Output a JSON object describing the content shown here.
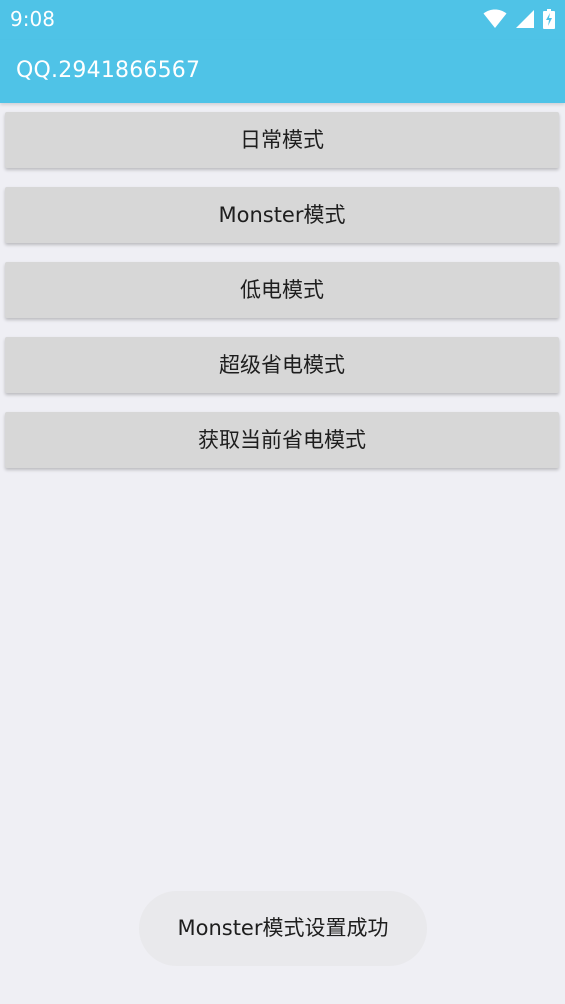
{
  "status_bar": {
    "time": "9:08",
    "icons": [
      "wifi-icon",
      "cell-signal-icon",
      "battery-charging-icon"
    ],
    "color": "#4fc3e7"
  },
  "app_bar": {
    "title": "QQ.2941866567",
    "color": "#4fc3e7"
  },
  "buttons": [
    {
      "label": "日常模式"
    },
    {
      "label": "Monster模式"
    },
    {
      "label": "低电模式"
    },
    {
      "label": "超级省电模式"
    },
    {
      "label": "获取当前省电模式"
    }
  ],
  "toast": {
    "message": "Monster模式设置成功"
  }
}
